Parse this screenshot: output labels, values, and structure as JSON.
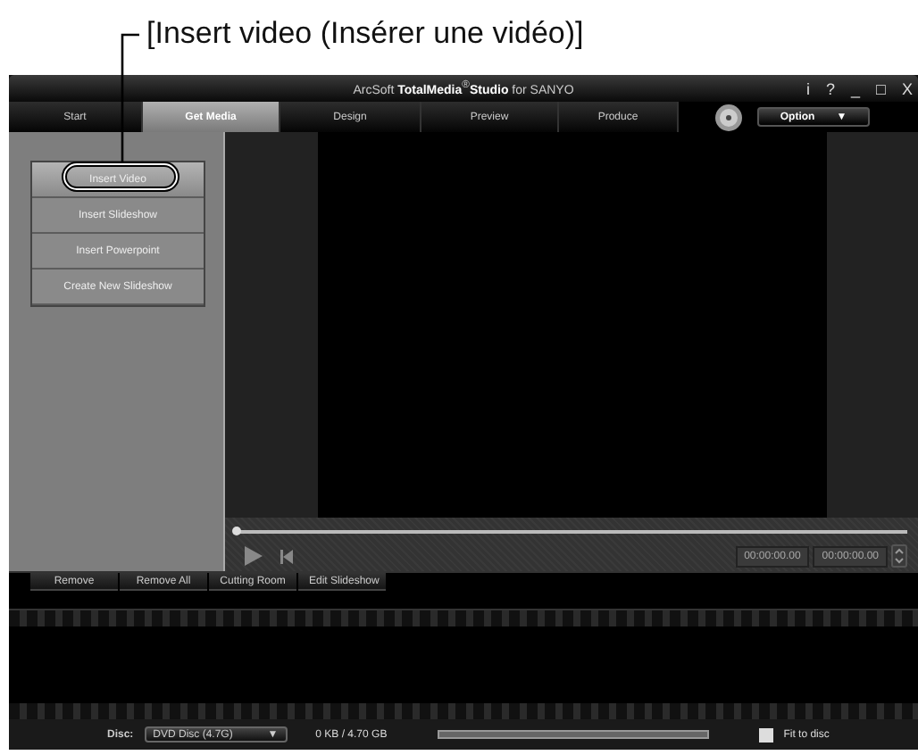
{
  "callout": "[Insert video (Insérer une vidéo)]",
  "window": {
    "title": "ArcSoft **TotalMedia**$^{®}$**Studio** for SANYO",
    "controls": [
      "i",
      "?",
      "_",
      "□",
      "X"
    ]
  },
  "tabs": [
    {
      "label": "Start",
      "selected": false
    },
    {
      "label": "Get Media",
      "selected": true
    },
    {
      "label": "Design",
      "selected": false
    },
    {
      "label": "Preview",
      "selected": false
    },
    {
      "label": "Produce",
      "selected": false
    }
  ],
  "option_button": {
    "label": "Option",
    "caret": "▼"
  },
  "menu": [
    {
      "label": "Insert Video",
      "selected": true
    },
    {
      "label": "Insert Slideshow",
      "selected": false
    },
    {
      "label": "Insert Powerpoint",
      "selected": false
    },
    {
      "label": "Create New Slideshow",
      "selected": false
    }
  ],
  "player": {
    "level": 0,
    "start_time": "00:00:00.00",
    "end_time": "00:00:00.00"
  },
  "actions": [
    "Remove",
    "Remove All",
    "Cutting Room",
    "Edit Slideshow"
  ],
  "status": {
    "disc_label": "Disc:",
    "disc": "DVD Disc (4.7G)",
    "caret": "▼",
    "usage": "0 KB / 4.70 GB",
    "level": 0,
    "fit_to_disc": {
      "label": "Fit to disc",
      "checked": false
    }
  }
}
